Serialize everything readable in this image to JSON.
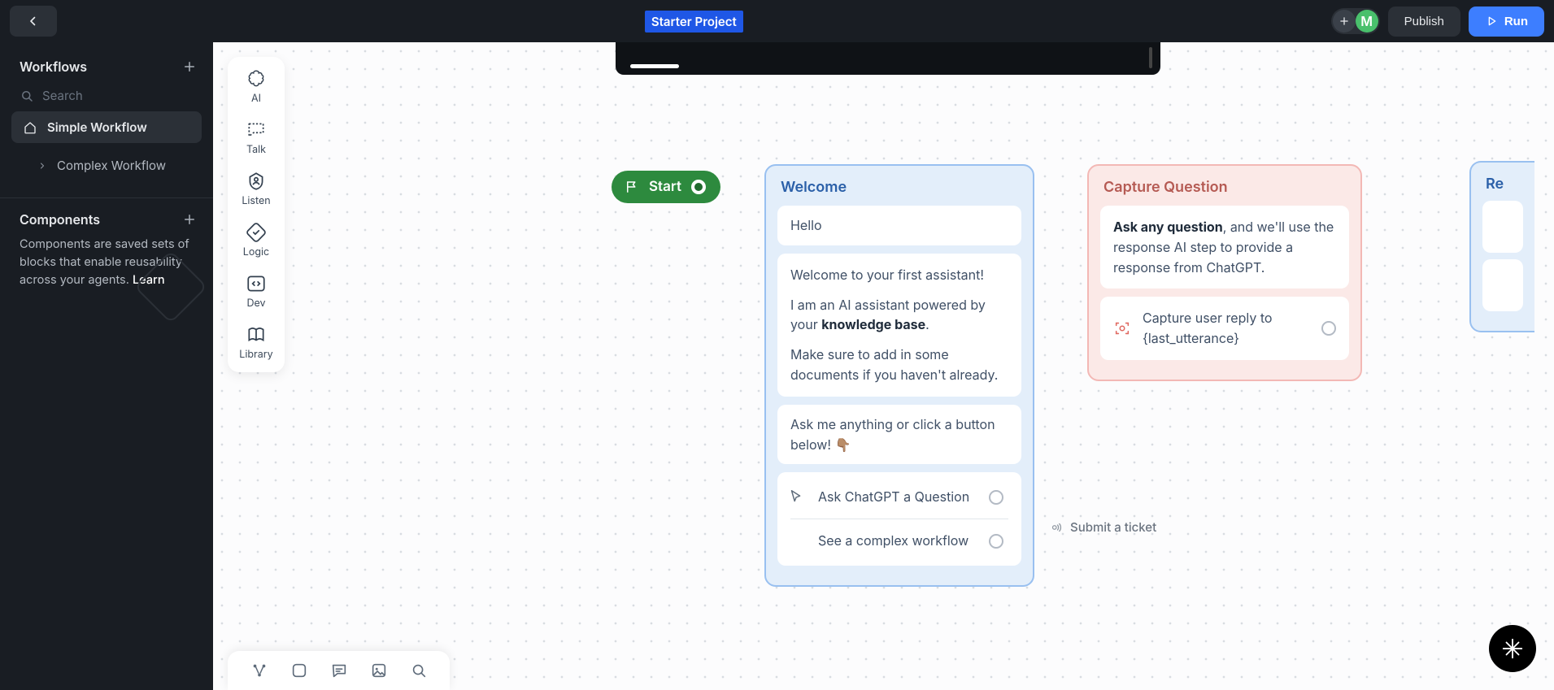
{
  "topbar": {
    "title": "Starter Project",
    "publish": "Publish",
    "run": "Run",
    "avatar_letter": "M"
  },
  "sidebar": {
    "workflows_header": "Workflows",
    "search_placeholder": "Search",
    "items": [
      {
        "label": "Simple Workflow"
      },
      {
        "label": "Complex Workflow"
      }
    ],
    "components_header": "Components",
    "components_blurb": "Components are saved sets of blocks that enable reusability across your agents. ",
    "components_learn": "Learn"
  },
  "tools": [
    {
      "label": "AI"
    },
    {
      "label": "Talk"
    },
    {
      "label": "Listen"
    },
    {
      "label": "Logic"
    },
    {
      "label": "Dev"
    },
    {
      "label": "Library"
    }
  ],
  "start_label": "Start",
  "welcome": {
    "title": "Welcome",
    "p1": "Hello",
    "p2": "Welcome to your first assistant!",
    "p3a": "I am an AI assistant powered by your ",
    "p3b": "knowledge base",
    "p3c": ".",
    "p4": "Make sure to add in some documents if you haven't already.",
    "p5": "Ask me anything or click a button below! 👇🏽",
    "opt1": "Ask ChatGPT a Question",
    "opt2": "See a complex workflow"
  },
  "capture": {
    "title": "Capture Question",
    "p1a": "Ask any question",
    "p1b": ", and we'll use the response AI step to provide a response from ChatGPT.",
    "row_label": "Capture user reply to {last_utterance}"
  },
  "submit_label": "Submit a ticket",
  "far_node_title": "Re"
}
